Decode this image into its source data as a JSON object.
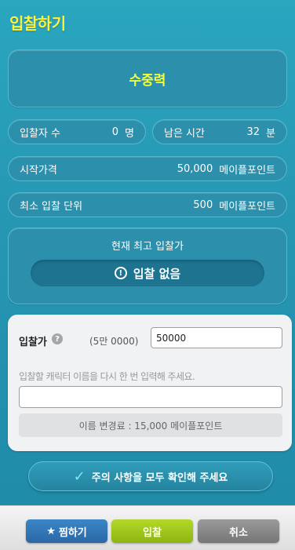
{
  "title": "입찰하기",
  "item_name": "수중력",
  "stats": {
    "bidders_label": "입찰자 수",
    "bidders_value": "0",
    "bidders_unit": "명",
    "remaining_label": "남은 시간",
    "remaining_value": "32",
    "remaining_unit": "분",
    "start_price_label": "시작가격",
    "start_price_value": "50,000",
    "start_price_unit": "메이플포인트",
    "min_unit_label": "최소 입찰 단위",
    "min_unit_value": "500",
    "min_unit_unit": "메이플포인트"
  },
  "highest": {
    "title": "현재 최고 입찰가",
    "no_bid_icon": "!",
    "no_bid_text": "입찰 없음"
  },
  "bid_form": {
    "bid_label": "입찰가",
    "help_icon": "?",
    "bid_hint": "(5만 0000)",
    "bid_value": "50000",
    "name_prompt": "입찰할 캐릭터 이름을 다시 한 번 입력해 주세요.",
    "name_value": "",
    "fee_text": "이름 변경료 : 15,000 메이플포인트"
  },
  "confirm": {
    "check_icon": "✓",
    "label": "주의 사항을 모두 확인해 주세요"
  },
  "footer": {
    "favorite_icon": "★",
    "favorite_label": "찜하기",
    "bid_label": "입찰",
    "cancel_label": "취소"
  },
  "colors": {
    "background": "#2697b3",
    "title": "#fff23a",
    "item_name": "#f4ff3a",
    "favorite": "#2a68a5",
    "bid": "#8db511",
    "cancel": "#767676"
  }
}
